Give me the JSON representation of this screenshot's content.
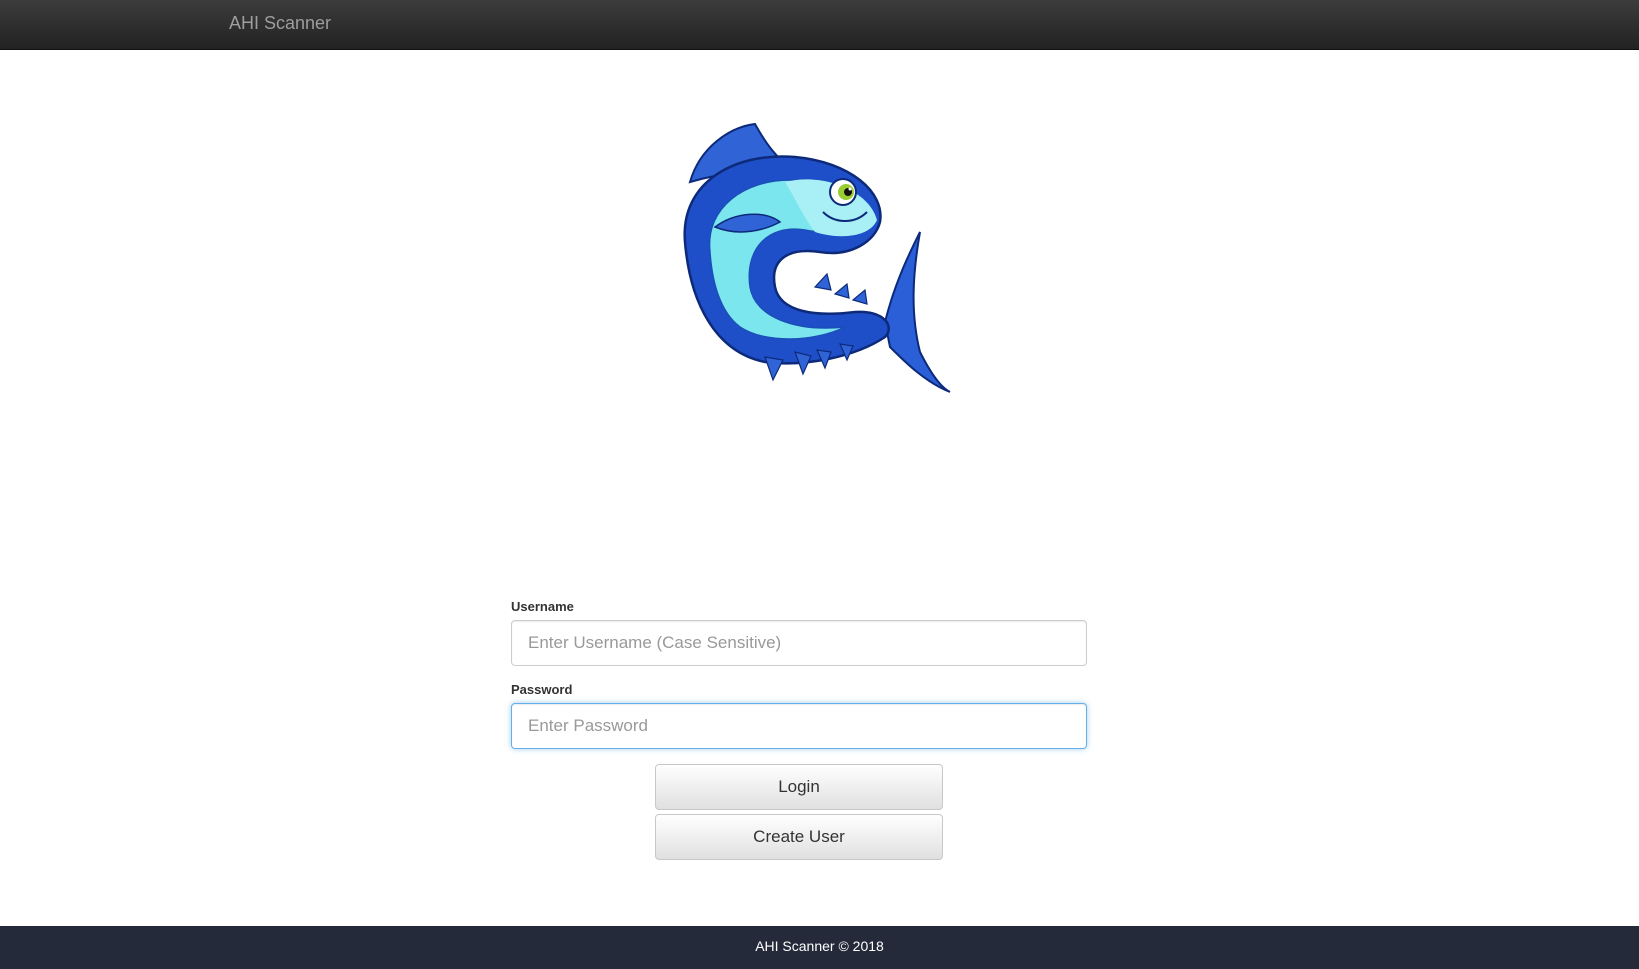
{
  "navbar": {
    "brand": "AHI Scanner"
  },
  "logo": {
    "icon": "fish-logo-icon",
    "colors": {
      "body_dark": "#1f4fc8",
      "body_light": "#7be6ee",
      "eye": "#9acd32"
    }
  },
  "login_form": {
    "username_label": "Username",
    "username_placeholder": "Enter Username (Case Sensitive)",
    "username_value": "",
    "password_label": "Password",
    "password_placeholder": "Enter Password",
    "password_value": "",
    "login_button": "Login",
    "create_user_button": "Create User"
  },
  "footer": {
    "text": "AHI Scanner © 2018"
  },
  "colors": {
    "navbar": "#222222",
    "footer": "#252a3a",
    "focus_border": "#66afe9"
  }
}
